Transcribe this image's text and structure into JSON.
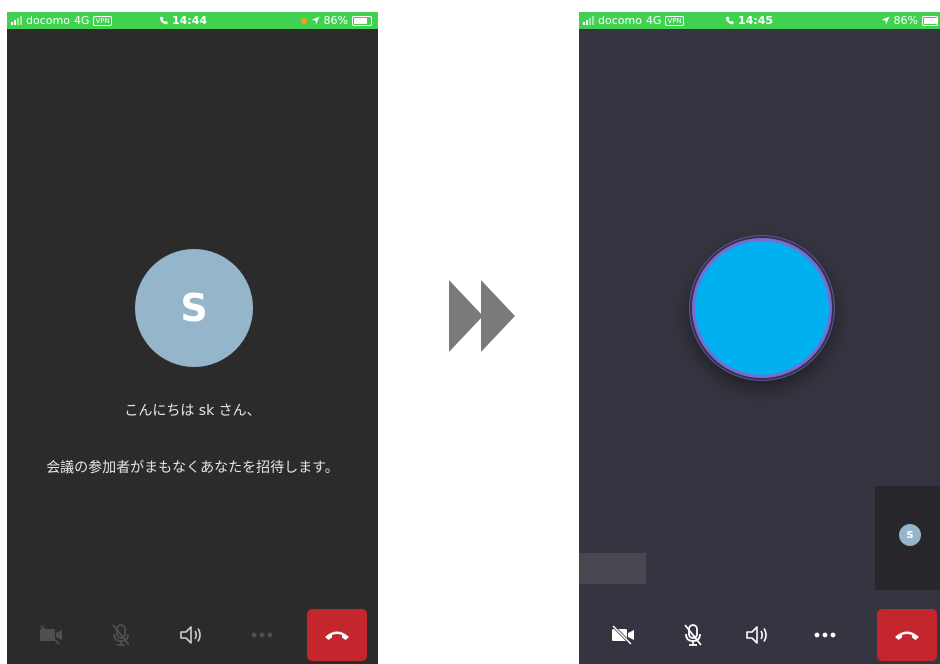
{
  "left_phone": {
    "status_bar": {
      "carrier": "docomo",
      "network": "4G",
      "vpn": "VPN",
      "time": "14:44",
      "battery": "86%"
    },
    "avatar_initial": "S",
    "greeting_line1": "こんにちは sk さん、",
    "greeting_line2": "会議の参加者がまもなくあなたを招待します。"
  },
  "right_phone": {
    "status_bar": {
      "carrier": "docomo",
      "network": "4G",
      "vpn": "VPN",
      "time": "14:45",
      "battery": "86%"
    },
    "self_avatar_initial": "S"
  },
  "colors": {
    "status_green": "#3fd14f",
    "left_background": "#2b2b2b",
    "right_background": "#353541",
    "avatar_blue_gray": "#95b5cb",
    "participant_cyan": "#00b0ef",
    "participant_ring": "#7a6ad4",
    "hangup_red": "#c4262e",
    "arrow_gray": "#7a7a7a"
  },
  "icons": {
    "toolbar": [
      "video-off-icon",
      "mic-off-icon",
      "speaker-icon",
      "more-icon",
      "hangup-icon"
    ],
    "status": [
      "signal-icon",
      "phone-icon",
      "location-arrow-icon",
      "battery-icon"
    ],
    "separator": "double-chevron-right-icon"
  }
}
